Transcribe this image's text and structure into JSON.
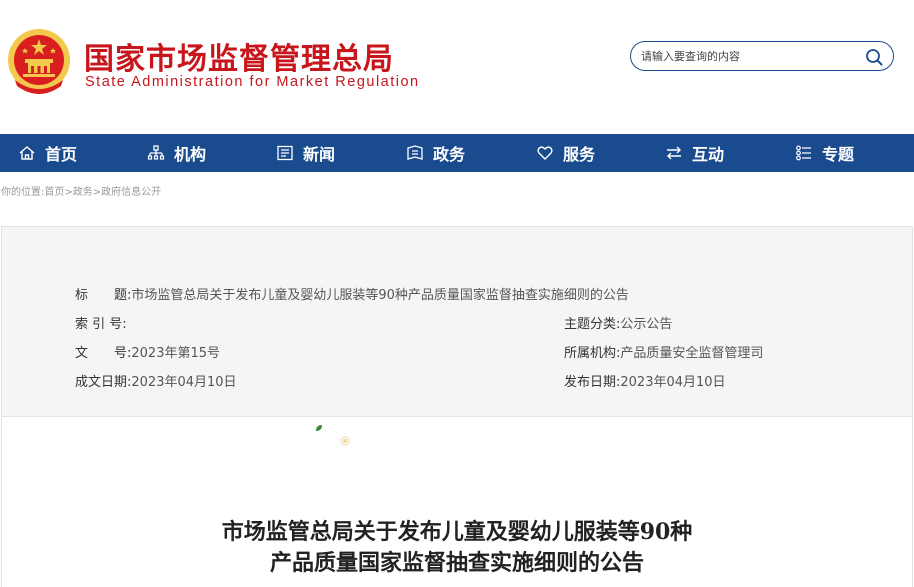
{
  "header": {
    "title": "国家市场监督管理总局",
    "subtitle": "State Administration for Market Regulation",
    "search_placeholder": "请输入要查询的内容"
  },
  "nav": {
    "items": [
      {
        "label": "首页",
        "icon": "home-icon"
      },
      {
        "label": "机构",
        "icon": "org-chart-icon"
      },
      {
        "label": "新闻",
        "icon": "news-icon"
      },
      {
        "label": "政务",
        "icon": "government-affairs-icon"
      },
      {
        "label": "服务",
        "icon": "heart-icon"
      },
      {
        "label": "互动",
        "icon": "exchange-arrows-icon"
      },
      {
        "label": "专题",
        "icon": "list-icon"
      }
    ]
  },
  "breadcrumb": {
    "prefix": "你的位置:",
    "items": [
      "首页",
      "政务",
      "政府信息公开"
    ],
    "separator": ">"
  },
  "info": {
    "title_label": "标　　题:",
    "title_value": "市场监管总局关于发布儿童及婴幼儿服装等90种产品质量国家监督抽查实施细则的公告",
    "index_label": "索 引 号:",
    "index_value": "",
    "category_label": "主题分类:",
    "category_value": "公示公告",
    "docno_label": "文　　号:",
    "docno_value": "2023年第15号",
    "org_label": "所属机构:",
    "org_value": "产品质量安全监督管理司",
    "created_label": "成文日期:",
    "created_value": "2023年04月10日",
    "published_label": "发布日期:",
    "published_value": "2023年04月10日"
  },
  "document": {
    "title_line1": "市场监管总局关于发布儿童及婴幼儿服装等90种",
    "title_line2": "产品质量国家监督抽查实施细则的公告"
  },
  "colors": {
    "brand_red": "#c8161d",
    "nav_blue": "#1b4b8f",
    "emblem_gold": "#f2c94c"
  }
}
